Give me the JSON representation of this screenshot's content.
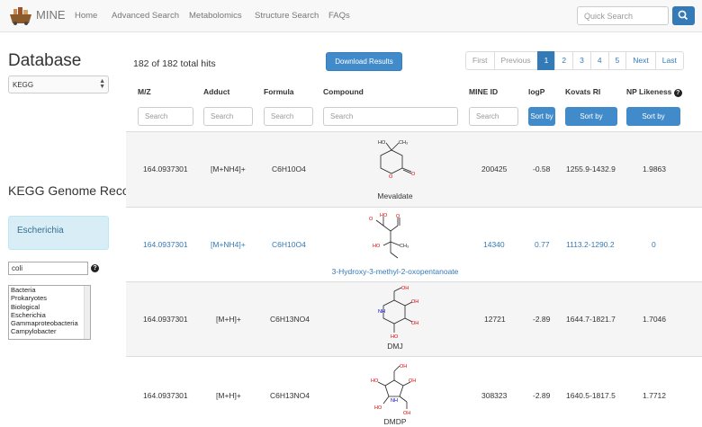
{
  "nav": {
    "brand": "MINE",
    "links": [
      "Home",
      "Advanced Search",
      "Metabolomics",
      "Structure Search",
      "FAQs"
    ],
    "quick_search_placeholder": "Quick Search"
  },
  "sidebar": {
    "database_heading": "Database",
    "database_selected": "KEGG",
    "genome_heading": "KEGG Genome Reconstructions",
    "organism": "Escherichia",
    "filter_value": "coli",
    "taxonomy": [
      "Bacteria",
      "Prokaryotes",
      "Biological",
      "Escherichia",
      "Gammaproteobacteria",
      "Campylobacter"
    ]
  },
  "results": {
    "hits": "182 of 182 total hits",
    "download_label": "Download Results",
    "pagination": [
      "First",
      "Previous",
      "1",
      "2",
      "3",
      "4",
      "5",
      "Next",
      "Last"
    ],
    "active_page": "1"
  },
  "table": {
    "headers": [
      "M/Z",
      "Adduct",
      "Formula",
      "Compound",
      "MINE ID",
      "logP",
      "Kovats RI",
      "NP Likeness"
    ],
    "search_placeholder": "Search",
    "sort_label": "Sort by",
    "rows": [
      {
        "mz": "164.0937301",
        "adduct": "[M+NH4]+",
        "formula": "C6H10O4",
        "compound": "Mevaldate",
        "mine_id": "200425",
        "logp": "-0.58",
        "kovats": "1255.9-1432.9",
        "np": "1.9863"
      },
      {
        "mz": "164.0937301",
        "adduct": "[M+NH4]+",
        "formula": "C6H10O4",
        "compound": "3-Hydroxy-3-methyl-2-oxopentanoate",
        "mine_id": "14340",
        "logp": "0.77",
        "kovats": "1113.2-1290.2",
        "np": "0"
      },
      {
        "mz": "164.0937301",
        "adduct": "[M+H]+",
        "formula": "C6H13NO4",
        "compound": "DMJ",
        "mine_id": "12721",
        "logp": "-2.89",
        "kovats": "1644.7-1821.7",
        "np": "1.7046"
      },
      {
        "mz": "164.0937301",
        "adduct": "[M+H]+",
        "formula": "C6H13NO4",
        "compound": "DMDP",
        "mine_id": "308323",
        "logp": "-2.89",
        "kovats": "1640.5-1817.5",
        "np": "1.7712"
      }
    ]
  },
  "colors": {
    "primary": "#428bca",
    "link": "#337ab7",
    "row_alt": "#f5f5f5",
    "panel": "#d9edf7"
  }
}
